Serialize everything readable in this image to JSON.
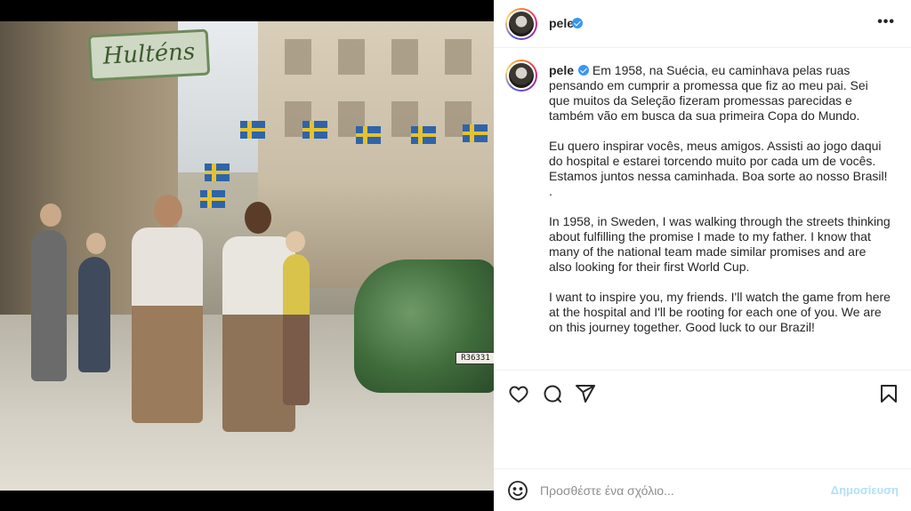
{
  "post": {
    "username": "pele",
    "verified": true,
    "more_icon": "ellipsis-icon",
    "photo": {
      "sign_text": "Hulténs",
      "plate_text": "R36331"
    },
    "caption": {
      "username": "pele",
      "paragraph_1": "Em 1958, na Suécia, eu caminhava pelas ruas pensando em cumprir a promessa que fiz ao meu pai. Sei que muitos da Seleção fizeram promessas parecidas e também vão em busca da sua primeira Copa do Mundo.",
      "paragraph_2": "Eu quero inspirar vocês, meus amigos. Assisti ao jogo daqui do hospital e estarei torcendo muito por cada um de vocês. Estamos juntos nessa caminhada. Boa sorte ao nosso Brasil!\n.",
      "paragraph_3": "In 1958, in Sweden, I was walking through the streets thinking about fulfilling the promise I made to my father. I know that many of the national team made similar promises and are also looking for their first World Cup.",
      "paragraph_4": "I want to inspire you, my friends. I'll watch the game from here at the hospital and I'll be rooting for each one of you. We are on this journey together. Good luck to our Brazil!"
    },
    "actions": {
      "like": "heart-icon",
      "comment": "comment-icon",
      "share": "share-icon",
      "save": "bookmark-icon"
    },
    "comment_box": {
      "placeholder": "Προσθέστε ένα σχόλιο...",
      "post_label": "Δημοσίευση",
      "emoji": "emoji-icon"
    }
  },
  "colors": {
    "verified_blue": "#3897f0",
    "post_button_disabled": "#b2dffc",
    "text_primary": "#262626",
    "placeholder": "#8e8e8e"
  }
}
